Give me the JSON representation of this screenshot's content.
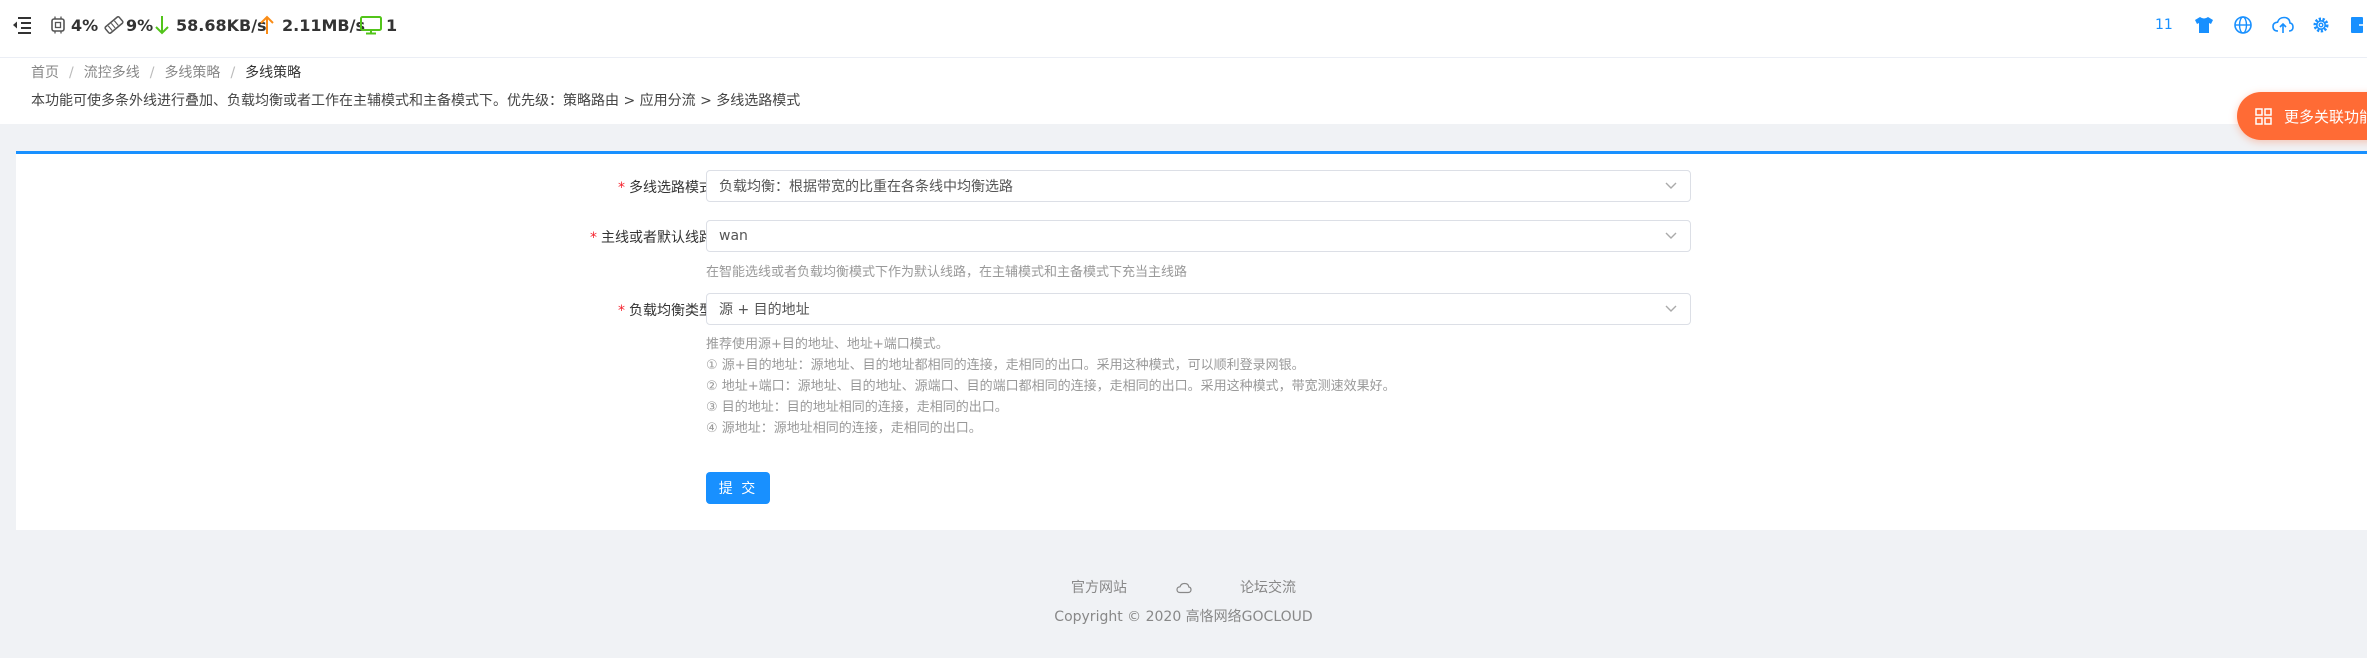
{
  "topbar": {
    "cpu": "4%",
    "memory": "9%",
    "download": "58.68KB/s",
    "upload": "2.11MB/s",
    "devices": "1",
    "notification_count": "11"
  },
  "breadcrumb": {
    "home": "首页",
    "level1": "流控多线",
    "level2": "多线策略",
    "current": "多线策略"
  },
  "description": "本功能可使多条外线进行叠加、负载均衡或者工作在主辅模式和主备模式下。优先级：策略路由 > 应用分流 > 多线选路模式",
  "float_button": "更多关联功能",
  "form": {
    "mode_label": "多线选路模式",
    "mode_value": "负载均衡：根据带宽的比重在各条线中均衡选路",
    "default_line_label": "主线或者默认线路",
    "default_line_value": "wan",
    "default_line_hint": "在智能选线或者负载均衡模式下作为默认线路，在主辅模式和主备模式下充当主线路",
    "balance_type_label": "负载均衡类型",
    "balance_type_value": "源 + 目的地址",
    "balance_help": [
      "推荐使用源+目的地址、地址+端口模式。",
      "① 源+目的地址：源地址、目的地址都相同的连接，走相同的出口。采用这种模式，可以顺利登录网银。",
      "② 地址+端口：源地址、目的地址、源端口、目的端口都相同的连接，走相同的出口。采用这种模式，带宽测速效果好。",
      "③ 目的地址：目的地址相同的连接，走相同的出口。",
      "④ 源地址：源地址相同的连接，走相同的出口。"
    ],
    "submit_label": "提 交"
  },
  "footer": {
    "link_official": "官方网站",
    "link_forum": "论坛交流",
    "copyright": "Copyright © 2020 高恪网络GOCLOUD"
  },
  "colors": {
    "primary": "#1890ff",
    "float_orange": "#ff6b35",
    "required": "#f5222d",
    "download_green": "#52c41a",
    "upload_orange": "#fa8c16"
  }
}
